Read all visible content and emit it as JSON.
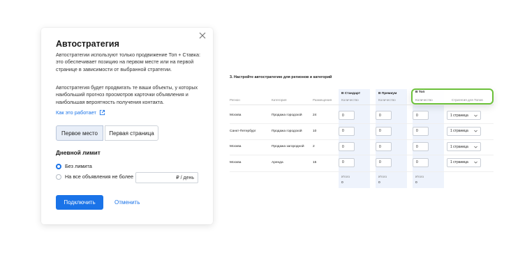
{
  "modal": {
    "title": "Автостратегия",
    "para1": "Автостратегии используют только продвижение Топ + Ставка: это обеспечивает позицию на первом месте или на первой странице в зависимости от выбранной стратегии.",
    "para2": "Автостратегия будет продвигать те ваши объекты, у которых наибольший прогноз просмотров карточки объявления и наибольшая вероятность получения контакта.",
    "link_label": "Как это работает",
    "segment": {
      "first": "Первое место",
      "second": "Первая страница",
      "selected": "Первое место"
    },
    "limit_title": "Дневной лимит",
    "radio_unlimited": "Без лимита",
    "radio_per_ad": "На все объявления не более",
    "limit_suffix": "₽ / день",
    "connect_button": "Подключить",
    "cancel_button": "Отменить",
    "icons": {
      "close": "close-icon",
      "external": "external-link-icon"
    },
    "accent": "#1a73e8"
  },
  "table": {
    "title": "3. Настройте автостратегию для регионов и категорий",
    "headers": {
      "region": "Регион",
      "category": "Категория",
      "placements": "Размещения",
      "standard": "В Стандарт",
      "premium": "В Премиум",
      "top": "В Топ",
      "quantity": "Количество",
      "top_strategy": "Стратегия для Топов"
    },
    "rows": [
      {
        "region": "Москва",
        "category": "Продажа городской",
        "placements": "24",
        "standard": "0",
        "premium": "0",
        "top": "0",
        "strategy": "1 страница"
      },
      {
        "region": "Санкт-Петербург",
        "category": "Продажа городской",
        "placements": "10",
        "standard": "0",
        "premium": "0",
        "top": "0",
        "strategy": "1 страница"
      },
      {
        "region": "Москва",
        "category": "Продажа загородной",
        "placements": "2",
        "standard": "0",
        "premium": "0",
        "top": "0",
        "strategy": "1 страница"
      },
      {
        "region": "Москва",
        "category": "Аренда",
        "placements": "15",
        "standard": "0",
        "premium": "0",
        "top": "0",
        "strategy": "1 страница"
      }
    ],
    "totals": {
      "label": "Итого",
      "standard": "0",
      "premium": "0",
      "top": "0"
    },
    "highlight_color": "#6cc13a"
  }
}
